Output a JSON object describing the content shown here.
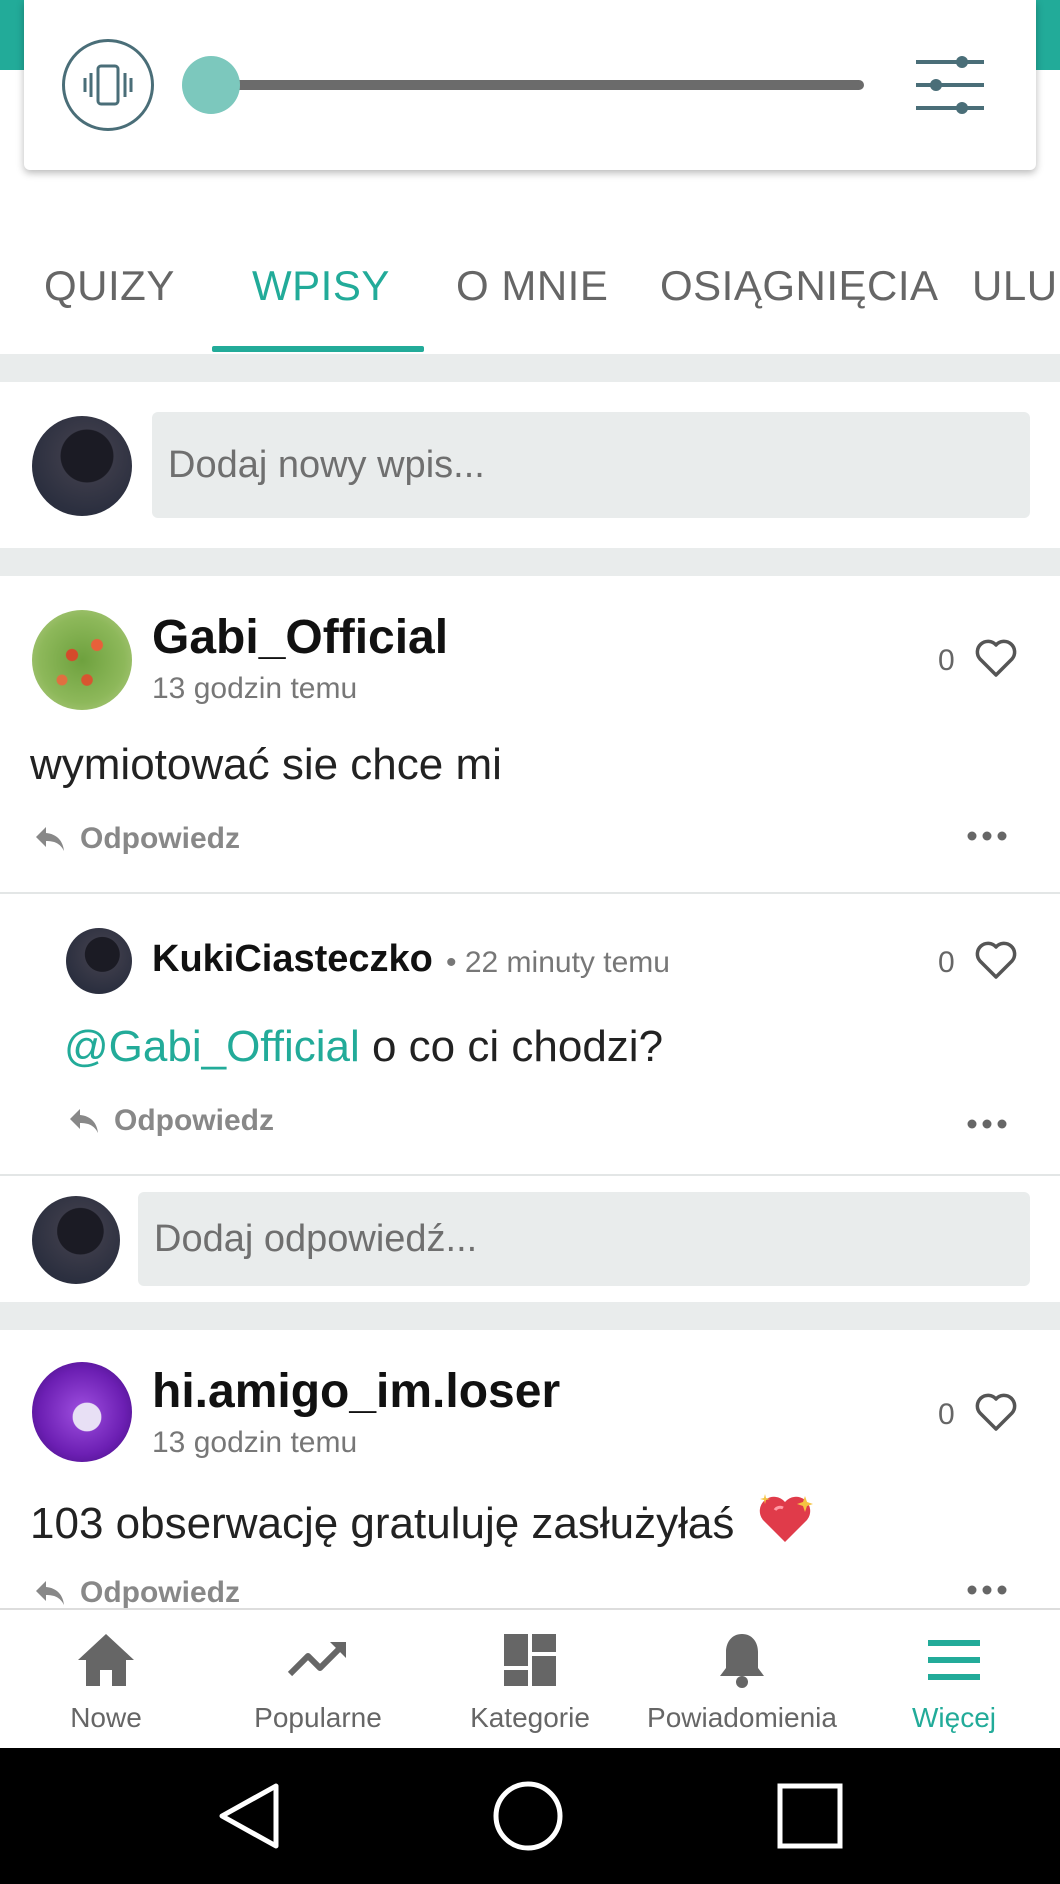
{
  "tabs": [
    {
      "label": "QUIZY"
    },
    {
      "label": "WPISY"
    },
    {
      "label": "O MNIE"
    },
    {
      "label": "OSIĄGNIĘCIA"
    },
    {
      "label": "ULUI"
    }
  ],
  "volume": {
    "level": 0.0
  },
  "composer": {
    "placeholder": "Dodaj nowy wpis..."
  },
  "posts": [
    {
      "username": "Gabi_Official",
      "time": "13 godzin temu",
      "text": "wymiotować sie chce mi",
      "likes": "0",
      "reply_label": "Odpowiedz"
    },
    {
      "username": "hi.amigo_im.loser",
      "time": "13 godzin temu",
      "text": "103 obserwację gratuluję zasłużyłaś",
      "likes": "0",
      "reply_label": "Odpowiedz"
    }
  ],
  "reply": {
    "username": "KukiCiasteczko",
    "time": "• 22 minuty temu",
    "mention": "@Gabi_Official",
    "text": " o co ci chodzi?",
    "likes": "0",
    "reply_label": "Odpowiedz"
  },
  "reply_composer": {
    "placeholder": "Dodaj odpowiedź..."
  },
  "bottom_nav": [
    {
      "label": "Nowe",
      "icon": "home-icon"
    },
    {
      "label": "Popularne",
      "icon": "trending-icon"
    },
    {
      "label": "Kategorie",
      "icon": "dashboard-icon"
    },
    {
      "label": "Powiadomienia",
      "icon": "bell-icon"
    },
    {
      "label": "Więcej",
      "icon": "menu-icon"
    }
  ],
  "colors": {
    "accent": "#22ab99",
    "divider": "#e9ecec"
  }
}
